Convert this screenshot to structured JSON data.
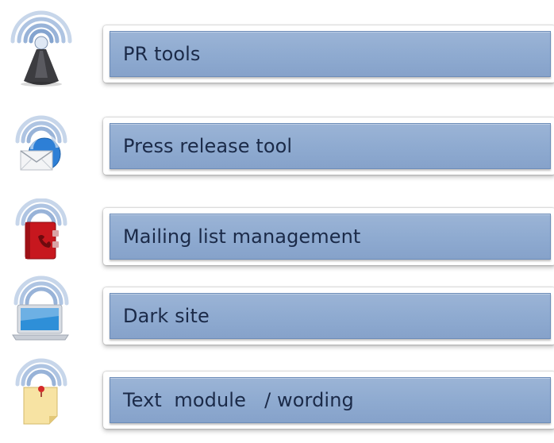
{
  "items": [
    {
      "label": "PR tools",
      "icon": "tower-broadcast-icon"
    },
    {
      "label": "Press release tool",
      "icon": "envelope-broadcast-icon"
    },
    {
      "label": "Mailing list management",
      "icon": "address-book-broadcast-icon"
    },
    {
      "label": "Dark site",
      "icon": "laptop-broadcast-icon"
    },
    {
      "label": "Text  module   / wording",
      "icon": "note-broadcast-icon"
    }
  ],
  "colors": {
    "bar_fill": "#8eaad0",
    "bar_border": "#6d8db9",
    "label_text": "#1b2a48",
    "signal_arc": "#9db6d8"
  }
}
